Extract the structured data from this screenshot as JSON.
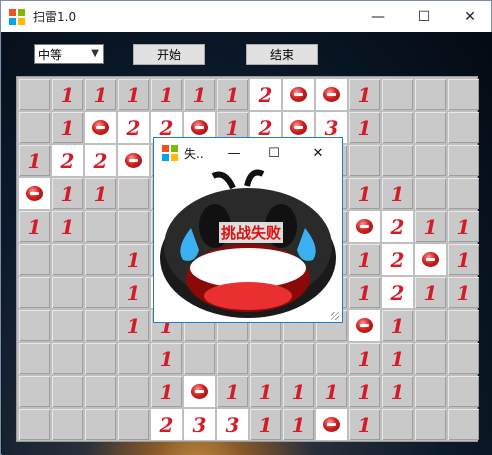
{
  "window": {
    "title": "扫雷1.0",
    "minimize_glyph": "—",
    "maximize_glyph": "☐",
    "close_glyph": "✕"
  },
  "toolbar": {
    "difficulty_value": "中等",
    "start_label": "开始",
    "end_label": "结束"
  },
  "board": {
    "rows": [
      [
        "",
        "1",
        "1",
        "1",
        "1",
        "1",
        "1",
        "2",
        "M",
        "M",
        "1",
        "",
        "",
        ""
      ],
      [
        "",
        "1",
        "M",
        "2",
        "2",
        "M",
        "1",
        "2",
        "M",
        "3",
        "1",
        "",
        "",
        ""
      ],
      [
        "1",
        "2",
        "2",
        "M",
        "",
        "",
        "",
        "",
        "",
        "",
        "",
        "",
        "",
        ""
      ],
      [
        "M",
        "1",
        "1",
        "",
        "",
        "",
        "",
        "",
        "",
        "",
        "1",
        "1",
        "",
        ""
      ],
      [
        "1",
        "1",
        "",
        "",
        "",
        "",
        "",
        "",
        "",
        "",
        "M",
        "2",
        "1",
        "1"
      ],
      [
        "",
        "",
        "",
        "1",
        "1",
        "",
        "",
        "",
        "",
        "",
        "1",
        "2",
        "M",
        "1"
      ],
      [
        "",
        "",
        "",
        "1",
        "M",
        "",
        "",
        "",
        "",
        "",
        "1",
        "2",
        "1",
        "1"
      ],
      [
        "",
        "",
        "",
        "1",
        "1",
        "",
        "",
        "",
        "",
        "",
        "M",
        "1",
        "",
        ""
      ],
      [
        "",
        "",
        "",
        "",
        "1",
        "",
        "",
        "",
        "",
        "",
        "1",
        "1",
        "",
        ""
      ],
      [
        "",
        "",
        "",
        "",
        "1",
        "M",
        "1",
        "1",
        "1",
        "1",
        "1",
        "1",
        "",
        ""
      ],
      [
        "",
        "",
        "",
        "",
        "2",
        "3",
        "3",
        "1",
        "1",
        "M",
        "1",
        "",
        "",
        ""
      ]
    ]
  },
  "dialog": {
    "title": "失..",
    "message": "挑战失败",
    "minimize_glyph": "—",
    "maximize_glyph": "☐",
    "close_glyph": "✕"
  }
}
